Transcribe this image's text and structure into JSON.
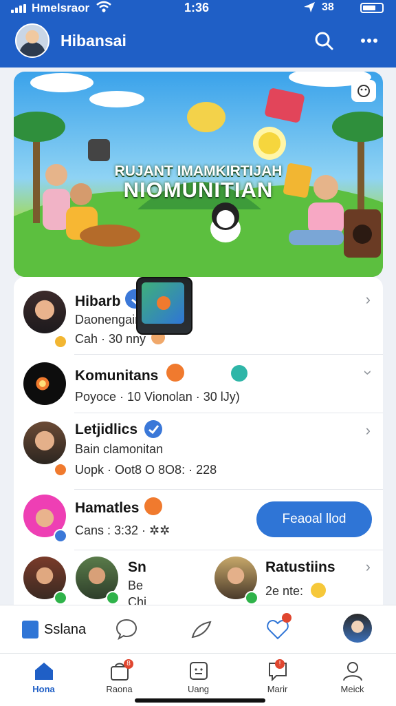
{
  "status_bar": {
    "carrier": "Hmelsraor",
    "time": "1:36",
    "battery": "38"
  },
  "header": {
    "title": "Hibansai"
  },
  "banner": {
    "line1": "RUJANT IMAMKIRTIJAH",
    "line2": "NIOMUNITIAN"
  },
  "list": [
    {
      "name": "Hibarb",
      "line1": "Daonengains sobsiall",
      "line2": "Cah · 30 nny",
      "accent": "#3b78d8"
    },
    {
      "name": "Komunitans",
      "line1": "Poyoce · 10  Vionolan · 30 lJy)",
      "accent": "#f07a2e"
    },
    {
      "name": "Letjidlics",
      "line1": "Bain clamonitan",
      "line2": "Uopk · Oot8   O 8O8: · 228",
      "accent": "#3b78d8"
    },
    {
      "name": "Hamatles",
      "line1": "Cans : 3:32 · ✲✲",
      "accent": "#f07a2e",
      "action": "Feaoal llod"
    },
    {
      "name": "Sn",
      "line1": "Be",
      "line2": "Chi"
    },
    {
      "name": "Ratustiins",
      "line1": "2e nte:"
    }
  ],
  "quickbar": {
    "compose": "Sslana"
  },
  "tabs": [
    {
      "label": "Hona",
      "icon": "home-icon",
      "active": true
    },
    {
      "label": "Raona",
      "icon": "bag-icon",
      "badge": "8"
    },
    {
      "label": "Uang",
      "icon": "chat-square-icon"
    },
    {
      "label": "Marir",
      "icon": "message-icon",
      "badge": "!"
    },
    {
      "label": "Meick",
      "icon": "profile-icon"
    }
  ],
  "colors": {
    "brand": "#1f5fc6",
    "accent_orange": "#f07a2e",
    "button_blue": "#2f75d6"
  }
}
